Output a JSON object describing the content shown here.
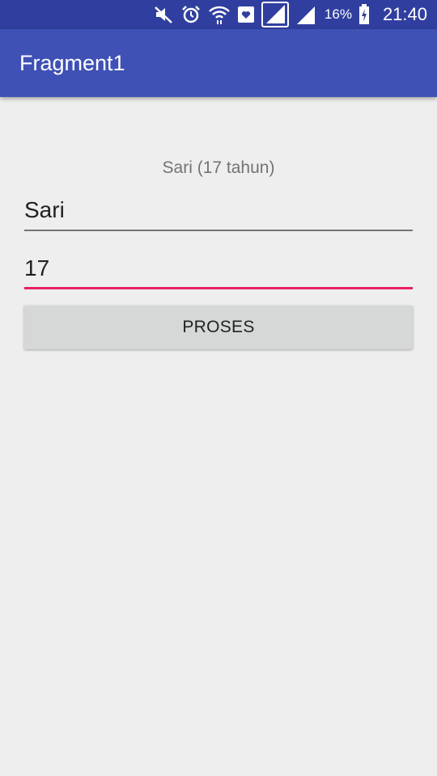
{
  "status_bar": {
    "icons": [
      "mute-icon",
      "alarm-icon",
      "wifi-icon",
      "heart-notification-icon",
      "signal-sim1-icon",
      "signal-sim2-icon",
      "battery-charging-icon"
    ],
    "battery_percent": "16%",
    "time": "21:40"
  },
  "app_bar": {
    "title": "Fragment1"
  },
  "main": {
    "result_text": "Sari (17 tahun)",
    "name_field_value": "Sari",
    "age_field_value": "17",
    "proses_label": "PROSES"
  },
  "colors": {
    "status_bar": "#303f9f",
    "app_bar": "#3f51b5",
    "accent": "#e91e63",
    "background": "#eeeeee"
  }
}
